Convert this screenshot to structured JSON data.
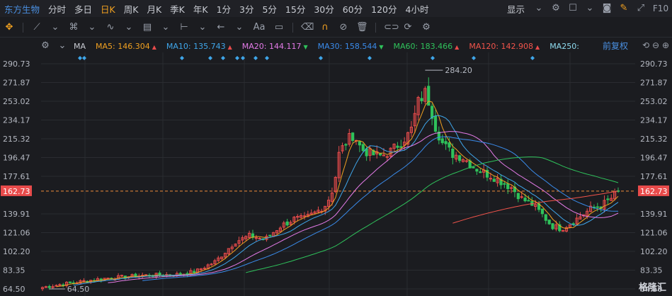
{
  "topbar": {
    "stock_name": "东方生物",
    "periods": [
      "分时",
      "多日",
      "日K",
      "周K",
      "月K",
      "季K",
      "年K",
      "1分",
      "3分",
      "5分",
      "15分",
      "30分",
      "60分",
      "120分",
      "4小时"
    ],
    "active_period": "日K",
    "display_label": "显示",
    "f10_label": "F10"
  },
  "toolbar": {
    "text_tool_label": "Aa"
  },
  "ma_bar": {
    "label": "MA",
    "items": [
      {
        "text": "MA5: 146.304",
        "arrow": "▲",
        "color": "#f0a020",
        "arrow_color": "#e84b4b"
      },
      {
        "text": "MA10: 135.743",
        "arrow": "▲",
        "color": "#3fa6ea",
        "arrow_color": "#e84b4b"
      },
      {
        "text": "MA20: 144.117",
        "arrow": "▼",
        "color": "#e47be8",
        "arrow_color": "#2fc25b"
      },
      {
        "text": "MA30: 158.544",
        "arrow": "▼",
        "color": "#3a8bea",
        "arrow_color": "#2fc25b"
      },
      {
        "text": "MA60: 183.466",
        "arrow": "▲",
        "color": "#2fc25b",
        "arrow_color": "#e84b4b"
      },
      {
        "text": "MA120: 142.908",
        "arrow": "▲",
        "color": "#f2544b",
        "arrow_color": "#e84b4b"
      },
      {
        "text": "MA250:",
        "arrow": "",
        "color": "#8fdcf0",
        "arrow_color": ""
      }
    ],
    "adjust_label": "前复权"
  },
  "watermark": "格隆汇",
  "colors": {
    "up": "#e84b4b",
    "down": "#2fc25b",
    "grid": "#2a2c31",
    "ma5": "#f0a020",
    "ma10": "#3fa6ea",
    "ma20": "#e47be8",
    "ma30": "#3a8bea",
    "ma60": "#2fc25b",
    "ma120": "#f2544b",
    "last_price": "#f08c3a"
  },
  "chart_data": {
    "type": "candlestick",
    "y_ticks": [
      "290.73",
      "271.87",
      "253.02",
      "234.17",
      "215.32",
      "196.47",
      "177.61",
      "162.73",
      "139.91",
      "121.06",
      "102.20",
      "83.35",
      "64.50"
    ],
    "ylim": [
      64.5,
      290.73
    ],
    "current_price_label": "162.73",
    "annotations": [
      {
        "text": "284.20",
        "value": 284.2
      },
      {
        "text": "64.50",
        "value": 64.5
      }
    ],
    "candles": [],
    "ma_series": {
      "ma5": [],
      "ma10": [],
      "ma20": [],
      "ma30": [],
      "ma60": [],
      "ma120": []
    },
    "markers_count": 14
  }
}
